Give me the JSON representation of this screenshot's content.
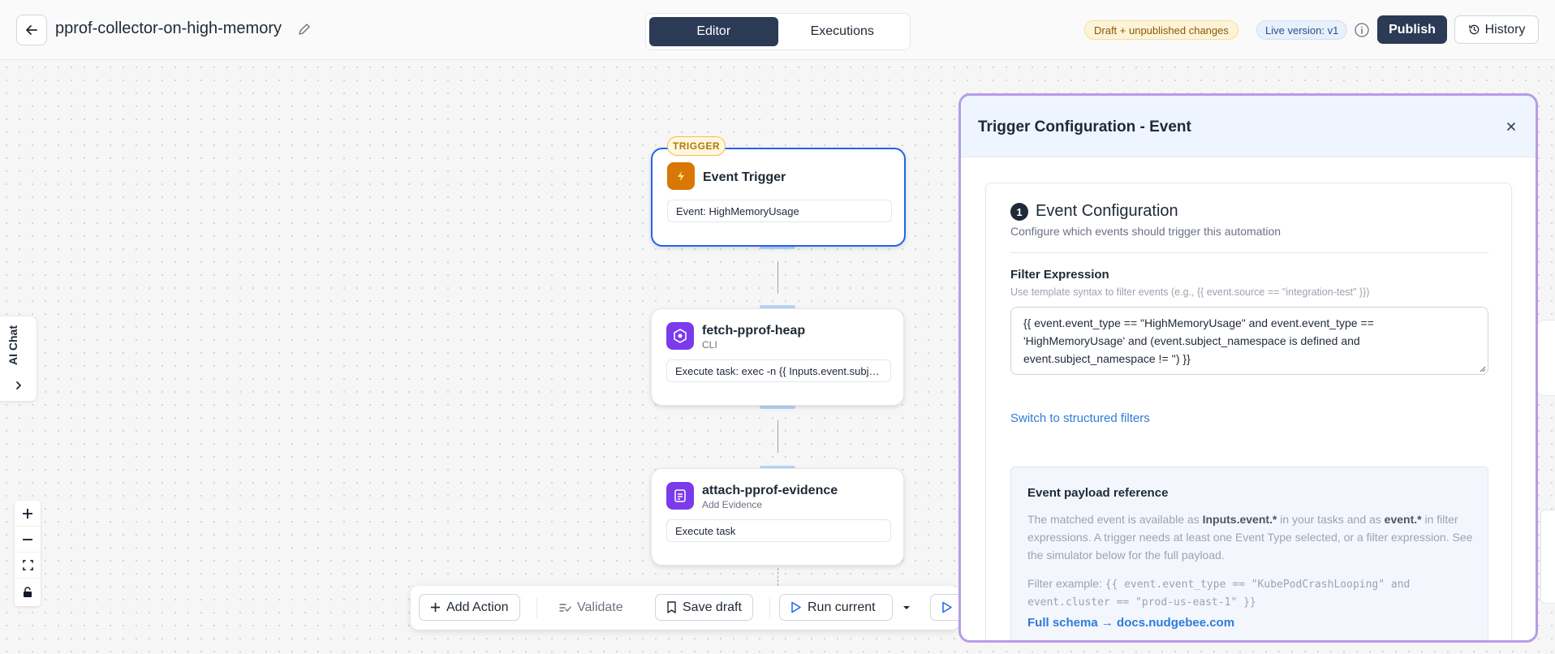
{
  "header": {
    "workflow_name": "pprof-collector-on-high-memory",
    "tabs": [
      {
        "label": "Editor",
        "active": true
      },
      {
        "label": "Executions",
        "active": false
      }
    ],
    "draft_badge": "Draft + unpublished changes",
    "live_badge": "Live version: v1",
    "publish_label": "Publish",
    "history_label": "History"
  },
  "left": {
    "ai_chat_label": "AI Chat"
  },
  "nodes": [
    {
      "badge": "TRIGGER",
      "title": "Event Trigger",
      "subtitle": "",
      "field": "Event: HighMemoryUsage",
      "icon": "lightning-icon",
      "icon_color": "#d97706"
    },
    {
      "title": "fetch-pprof-heap",
      "subtitle": "CLI",
      "field": "Execute task: exec -n {{ Inputs.event.subject_namespace }}",
      "icon": "kubernetes-icon",
      "icon_color": "#7c3aed"
    },
    {
      "title": "attach-pprof-evidence",
      "subtitle": "Add Evidence",
      "field": "Execute task",
      "icon": "document-icon",
      "icon_color": "#7c3aed"
    }
  ],
  "toolbar": {
    "add_action": "Add Action",
    "validate": "Validate",
    "save_draft": "Save draft",
    "run_current": "Run current"
  },
  "panel": {
    "title": "Trigger Configuration - Event",
    "step_number": "1",
    "section_title": "Event Configuration",
    "section_subtitle": "Configure which events should trigger this automation",
    "filter_label": "Filter Expression",
    "filter_hint": "Use template syntax to filter events (e.g., {{ event.source == \"integration-test\" }})",
    "filter_value": "{{ event.event_type == \"HighMemoryUsage\" and event.event_type == 'HighMemoryUsage' and (event.subject_namespace is defined and event.subject_namespace != '') }}",
    "switch_link": "Switch to structured filters",
    "ref_title": "Event payload reference",
    "ref_text_1": "The matched event is available as ",
    "ref_bold_1": "Inputs.event.*",
    "ref_text_2": " in your tasks and as ",
    "ref_bold_2": "event.*",
    "ref_text_3": " in filter expressions. A trigger needs at least one Event Type selected, or a filter expression. See the simulator below for the full payload.",
    "ref_example_label": "Filter example: ",
    "ref_example_code": "{{ event.event_type == \"KubePodCrashLooping\" and event.cluster == \"prod-us-east-1\" }}",
    "ref_link": "Full schema → docs.nudgebee.com"
  },
  "colors": {
    "primary_dark": "#2b3a55",
    "accent_blue": "#2563eb",
    "panel_border": "#b79ce6",
    "link": "#2f7bd9"
  }
}
